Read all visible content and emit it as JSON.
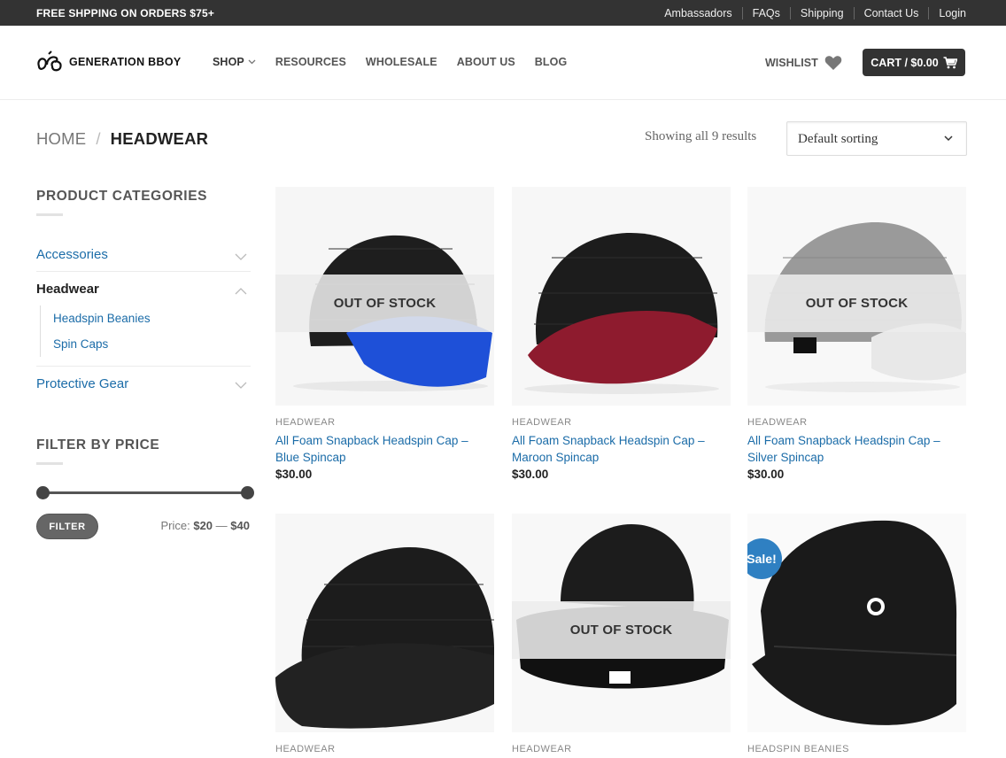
{
  "topbar": {
    "promo": "FREE SHPPING ON ORDERS $75+",
    "links": [
      "Ambassadors",
      "FAQs",
      "Shipping",
      "Contact Us",
      "Login"
    ]
  },
  "header": {
    "logo_text": "GENERATION BBOY",
    "nav": [
      {
        "label": "SHOP",
        "has_dropdown": true
      },
      {
        "label": "RESOURCES"
      },
      {
        "label": "WHOLESALE"
      },
      {
        "label": "ABOUT US"
      },
      {
        "label": "BLOG"
      }
    ],
    "wishlist": "WISHLIST",
    "cart": "CART / $0.00"
  },
  "breadcrumb": {
    "home": "HOME",
    "separator": "/",
    "current": "HEADWEAR"
  },
  "results_text": "Showing all 9 results",
  "sort": {
    "selected": "Default sorting"
  },
  "sidebar": {
    "categories_title": "PRODUCT CATEGORIES",
    "categories": [
      {
        "label": "Accessories"
      },
      {
        "label": "Headwear",
        "active": true,
        "children": [
          "Headspin Beanies",
          "Spin Caps"
        ]
      },
      {
        "label": "Protective Gear"
      }
    ],
    "price_title": "FILTER BY PRICE",
    "filter_button": "FILTER",
    "price_prefix": "Price:",
    "price_min": "$20",
    "price_dash": "—",
    "price_max": "$40"
  },
  "products": [
    {
      "category": "HEADWEAR",
      "name": "All Foam Snapback Headspin Cap – Blue Spincap",
      "price": "$30.00",
      "badge": "OUT OF STOCK",
      "brim": "#1e50d8"
    },
    {
      "category": "HEADWEAR",
      "name": "All Foam Snapback Headspin Cap – Maroon Spincap",
      "price": "$30.00",
      "badge": "",
      "brim": "#8e1b2e"
    },
    {
      "category": "HEADWEAR",
      "name": "All Foam Snapback Headspin Cap – Silver Spincap",
      "price": "$30.00",
      "badge": "OUT OF STOCK",
      "brim": "#e8e8e8"
    },
    {
      "category": "HEADWEAR",
      "name": "",
      "price": "",
      "badge": "",
      "brim": "#222222"
    },
    {
      "category": "HEADWEAR",
      "name": "",
      "price": "",
      "badge": "OUT OF STOCK",
      "brim": "#111111"
    },
    {
      "category": "HEADSPIN BEANIES",
      "name": "",
      "price": "",
      "badge": "Sale!",
      "brim": "#1a1a1a"
    }
  ],
  "colors": {
    "link": "#1b6ca8",
    "topbar": "#333333",
    "sale": "#2f80c2"
  }
}
